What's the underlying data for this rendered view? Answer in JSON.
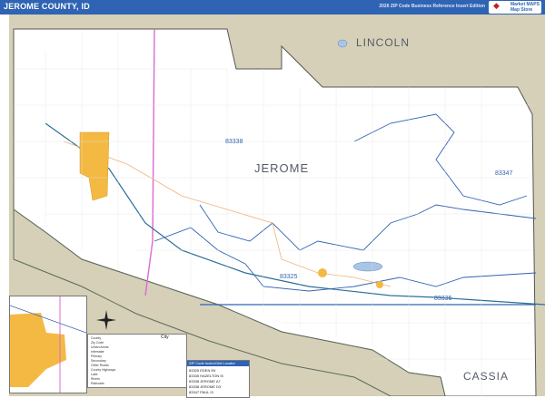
{
  "header": {
    "title": "JEROME COUNTY, ID",
    "subtitle": "2026 ZIP Code Business Reference Insert Edition",
    "logo_text": "Market MAPS",
    "logo_sub": "Map Store"
  },
  "colors": {
    "header": "#2f63b3",
    "outside": "#d6d0b8",
    "county": "#ffffff",
    "river": "#4a5a4a",
    "zip_boundary": "#2f63b3",
    "city": "#f4b942",
    "highway": "#d86bd2",
    "road": "#f2b07a"
  },
  "regions": {
    "main": "JEROME",
    "north": "LINCOLN",
    "south": "CASSIA"
  },
  "zips": [
    {
      "code": "83338"
    },
    {
      "code": "83347"
    },
    {
      "code": "83325"
    },
    {
      "code": "83335"
    }
  ],
  "legend": {
    "rows": [
      "County",
      "Zip Code",
      "Urban Areas",
      "Interstate",
      "Primary",
      "Secondary",
      "Other Roads",
      "County Highways",
      "Lake",
      "Rivers",
      "Railroads"
    ],
    "city_label": "City"
  },
  "zip_index": {
    "title": "ZIP Code Index/Grid Locator",
    "rows": [
      {
        "zip": "83325",
        "name": "EDEN",
        "grid": "E6"
      },
      {
        "zip": "83335",
        "name": "HAZELTON",
        "grid": "I5"
      },
      {
        "zip": "83338",
        "name": "JEROME",
        "grid": "A7"
      },
      {
        "zip": "83338",
        "name": "JEROME",
        "grid": "D3"
      },
      {
        "zip": "83347",
        "name": "PAUL",
        "grid": "I3"
      }
    ]
  }
}
